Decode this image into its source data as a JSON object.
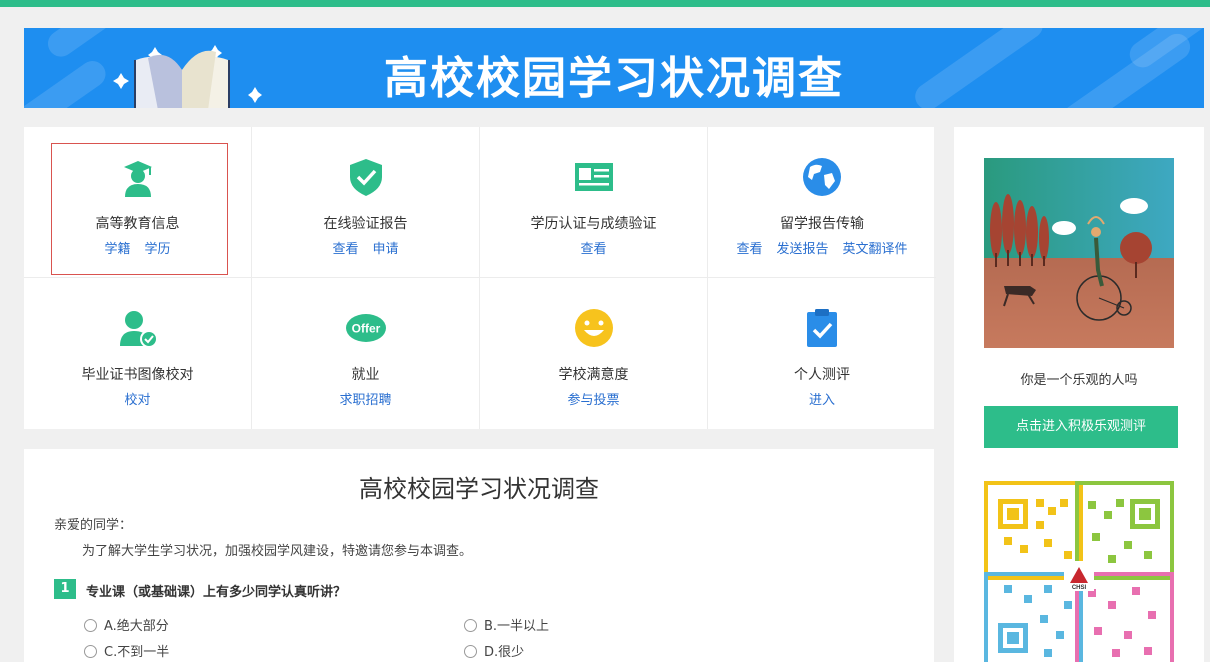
{
  "banner": {
    "title": "高校校园学习状况调查"
  },
  "services": [
    {
      "icon": "graduate-icon",
      "name": "高等教育信息",
      "links": [
        "学籍",
        "学历"
      ]
    },
    {
      "icon": "shield-check-icon",
      "name": "在线验证报告",
      "links": [
        "查看",
        "申请"
      ]
    },
    {
      "icon": "certificate-card-icon",
      "name": "学历认证与成绩验证",
      "links": [
        "查看"
      ]
    },
    {
      "icon": "globe-icon",
      "name": "留学报告传输",
      "links": [
        "查看",
        "发送报告",
        "英文翻译件"
      ]
    },
    {
      "icon": "user-check-icon",
      "name": "毕业证书图像校对",
      "links": [
        "校对"
      ]
    },
    {
      "icon": "offer-badge-icon",
      "badge": "Offer",
      "name": "就业",
      "links": [
        "求职招聘"
      ]
    },
    {
      "icon": "smiley-icon",
      "name": "学校满意度",
      "links": [
        "参与投票"
      ]
    },
    {
      "icon": "clipboard-check-icon",
      "name": "个人测评",
      "links": [
        "进入"
      ]
    }
  ],
  "survey": {
    "title": "高校校园学习状况调查",
    "greeting": "亲爱的同学：",
    "intro": "为了解大学生学习状况，加强校园学风建设，特邀请您参与本调查。",
    "question": {
      "number": "1",
      "text": "专业课（或基础课）上有多少同学认真听讲？",
      "options": [
        "A.绝大部分",
        "B.一半以上",
        "C.不到一半",
        "D.很少"
      ]
    }
  },
  "sidebar": {
    "caption": "你是一个乐观的人吗",
    "cta": "点击进入积极乐观测评",
    "qr_logo_text": "CHSI"
  },
  "colors": {
    "accent": "#2dbd8a",
    "banner": "#1e8ef0",
    "link": "#2a6fd0"
  }
}
